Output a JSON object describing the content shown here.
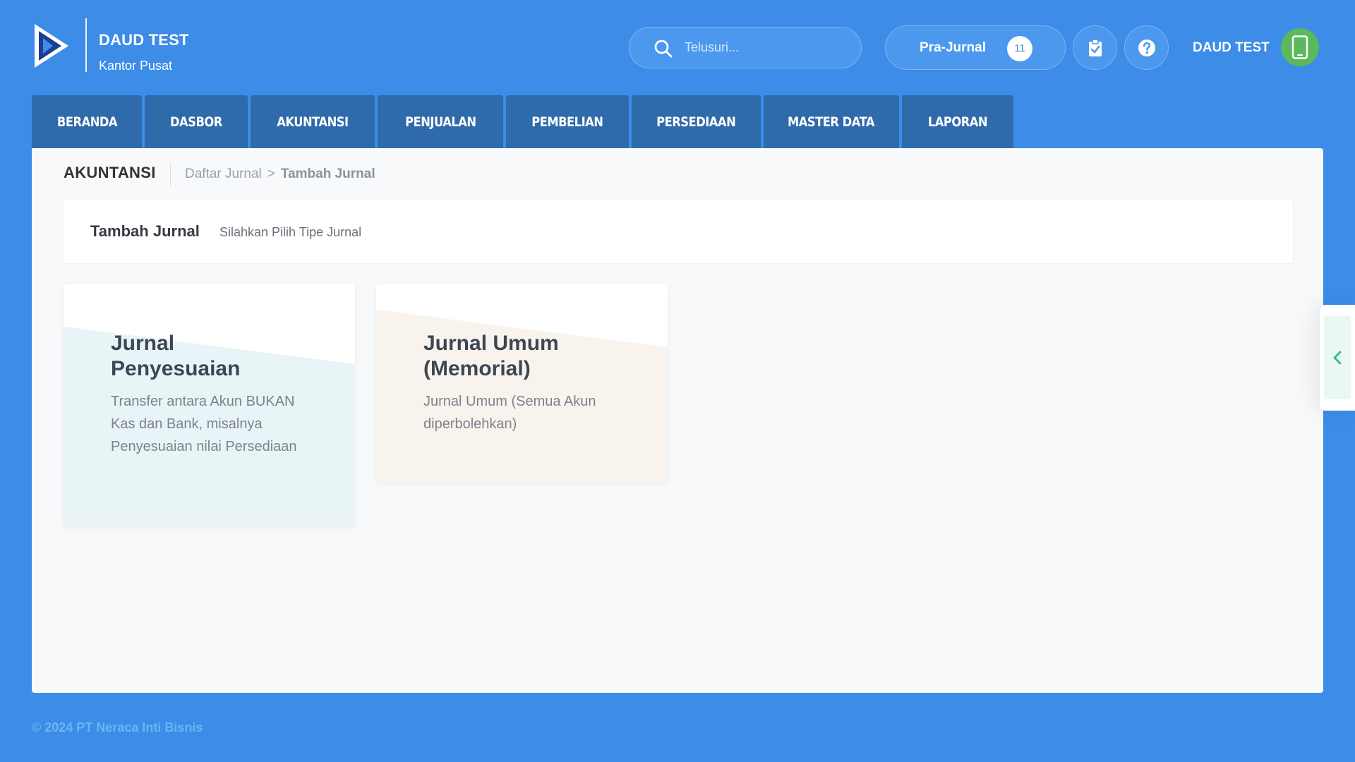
{
  "header": {
    "company_name": "DAUD TEST",
    "branch": "Kantor Pusat",
    "search_placeholder": "Telusuri...",
    "prajurnal_label": "Pra-Jurnal",
    "prajurnal_count": "11",
    "user_name": "DAUD TEST",
    "icons": {
      "logo": "app-logo-icon",
      "search": "search-icon",
      "clipboard": "clipboard-check-icon",
      "help": "help-icon",
      "avatar": "mobile-phone-icon"
    }
  },
  "nav": {
    "tabs": [
      {
        "label": "BERANDA"
      },
      {
        "label": "DASBOR"
      },
      {
        "label": "AKUNTANSI"
      },
      {
        "label": "PENJUALAN"
      },
      {
        "label": "PEMBELIAN"
      },
      {
        "label": "PERSEDIAAN"
      },
      {
        "label": "MASTER DATA"
      },
      {
        "label": "LAPORAN"
      }
    ]
  },
  "breadcrumb": {
    "section": "AKUNTANSI",
    "link": "Daftar Jurnal",
    "separator": ">",
    "current": "Tambah Jurnal"
  },
  "title_card": {
    "title": "Tambah Jurnal",
    "subtitle": "Silahkan Pilih Tipe Jurnal"
  },
  "cards": [
    {
      "title_line1": "Jurnal",
      "title_line2": "Penyesuaian",
      "description": "Transfer antara Akun BUKAN Kas dan Bank, misalnya Penyesuaian nilai Persediaan"
    },
    {
      "title_line1": "Jurnal Umum",
      "title_line2": "(Memorial)",
      "description": "Jurnal Umum (Semua Akun diperbolehkan)"
    }
  ],
  "footer": {
    "copyright": "© 2024 PT Neraca Inti Bisnis"
  },
  "colors": {
    "background": "#3c8ce8",
    "nav_tab": "#2f6aab",
    "panel": "#f8f9fb",
    "card_penyesuaian_tint": "#e9f4f7",
    "card_umum_tint": "#f8f3ec",
    "avatar": "#5cb85c",
    "side_toggle_accent": "#2fbf94"
  }
}
